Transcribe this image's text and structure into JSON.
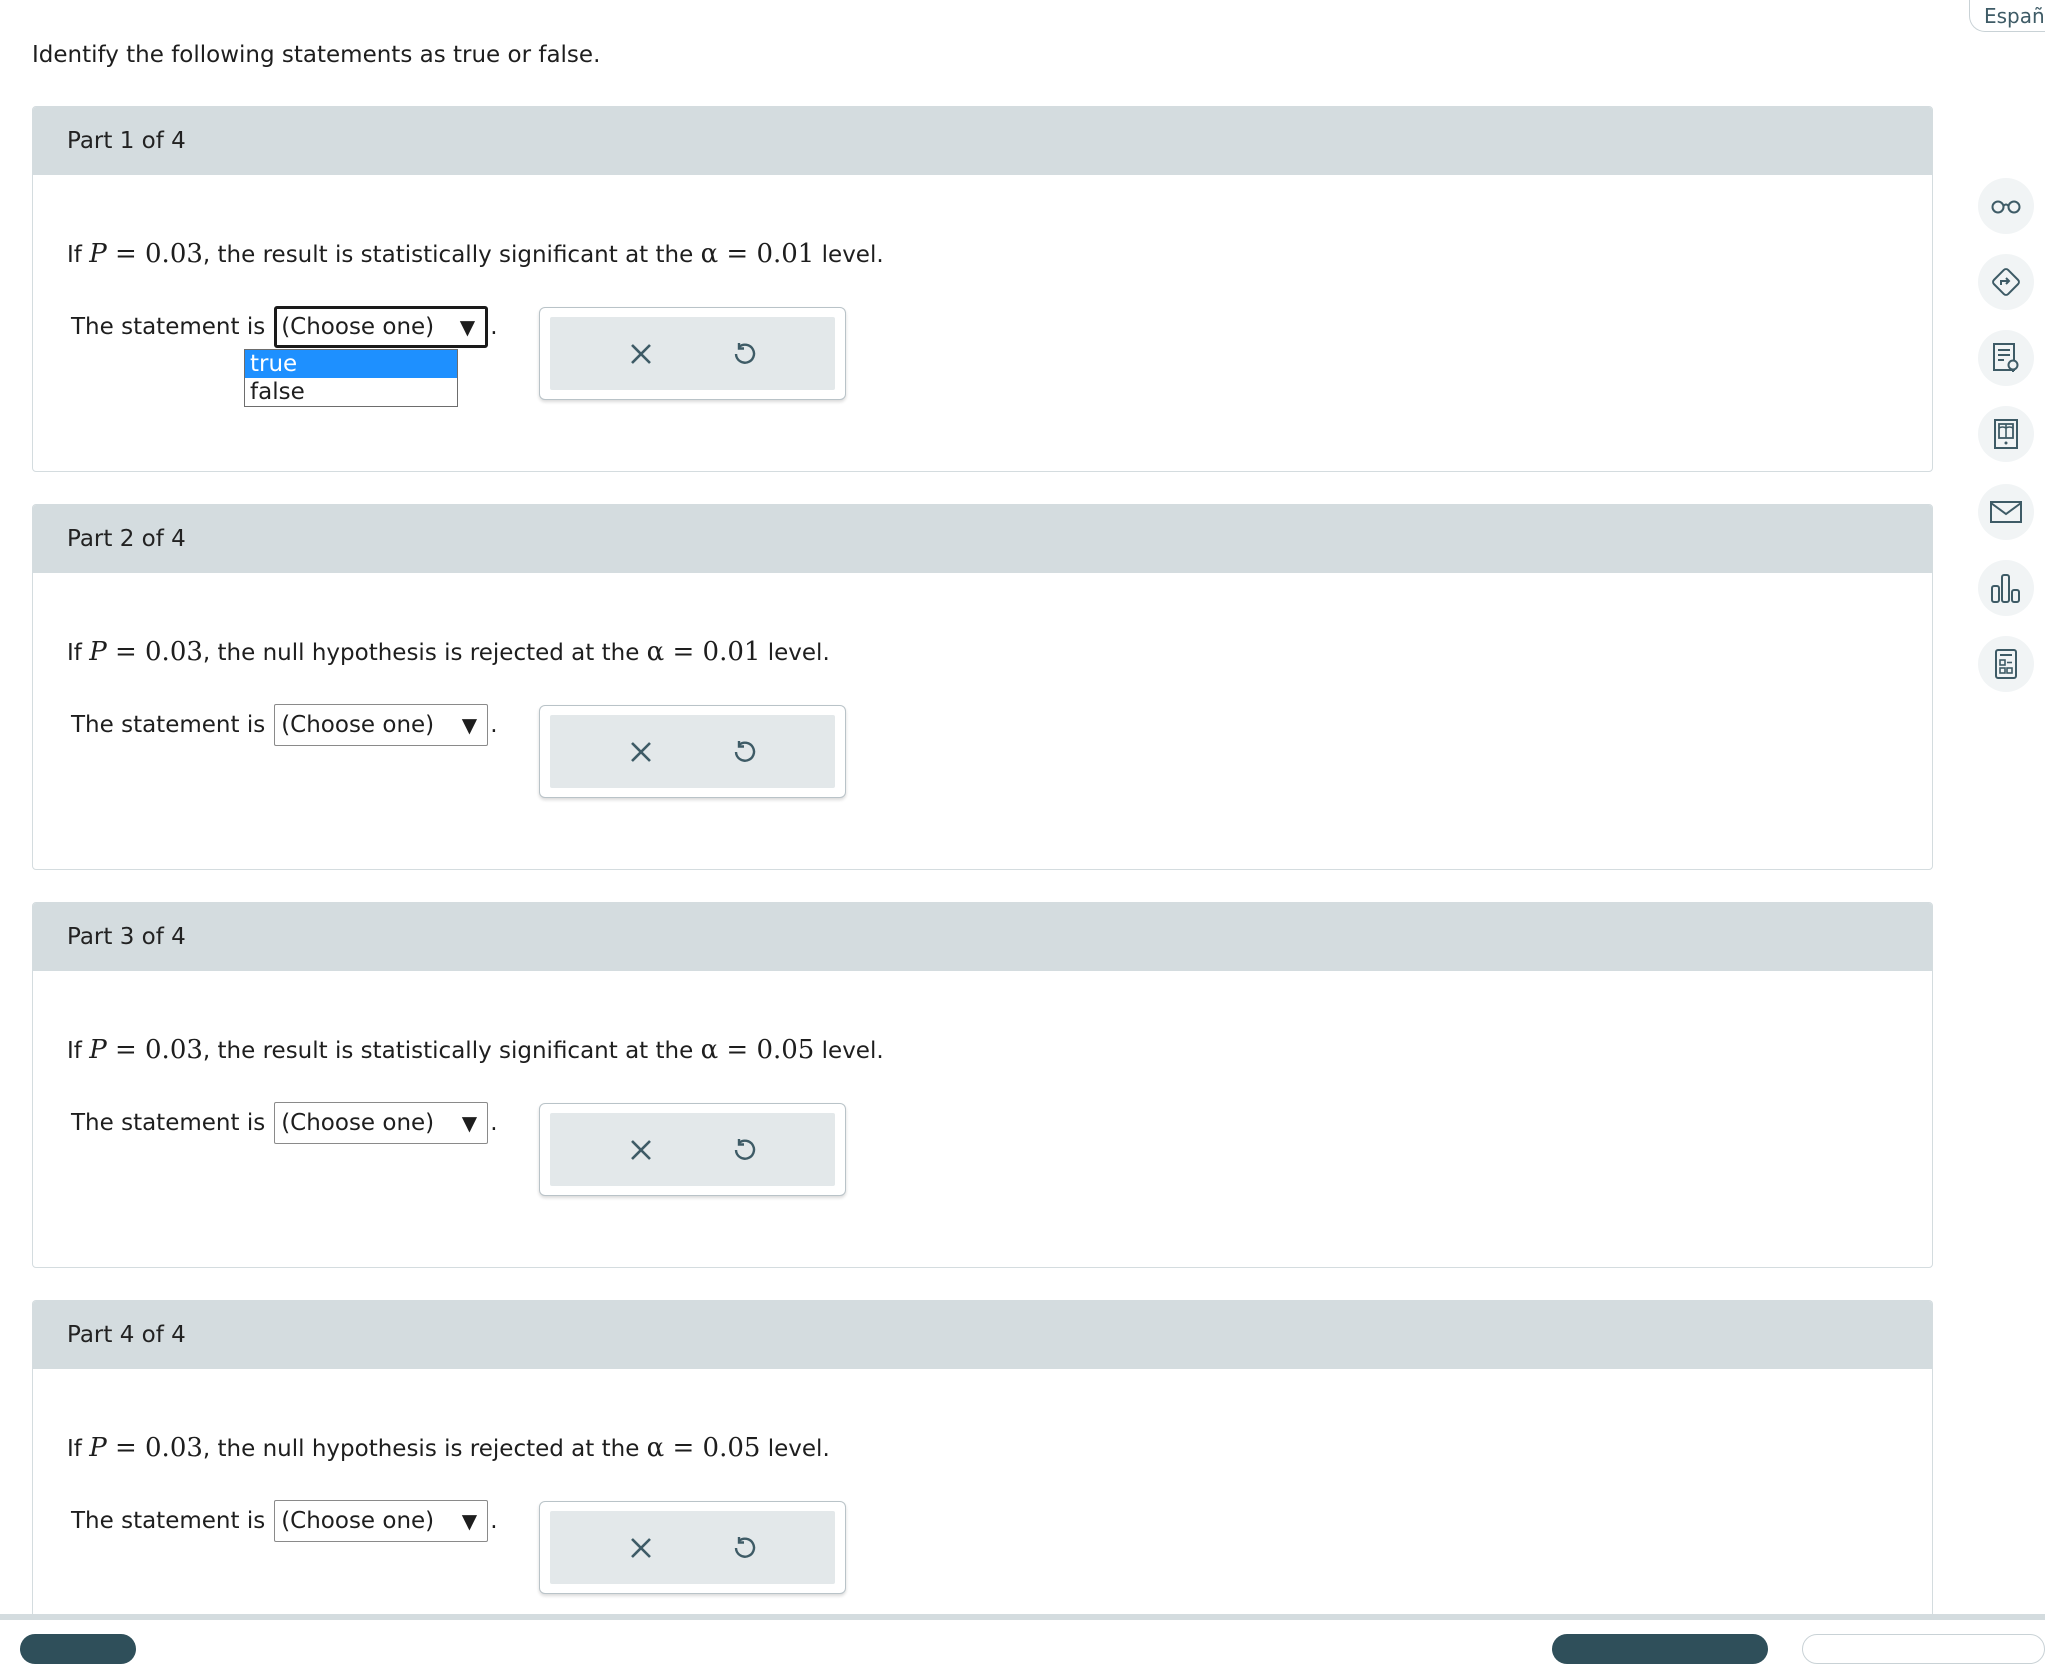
{
  "instructions": "Identify the following statements as true or false.",
  "language_link": "Españo",
  "answer_prefix": "The statement is",
  "parts": [
    {
      "header": "Part 1 of 4",
      "question": {
        "pre": "If ",
        "p_sym": "P",
        "p_eq": " = 0.03",
        "mid": ", the result is statistically significant at the ",
        "alpha_sym": "α",
        "alpha_eq": " = 0.01",
        "post": " level."
      },
      "select_value": "(Choose one)",
      "open": true
    },
    {
      "header": "Part 2 of 4",
      "question": {
        "pre": "If ",
        "p_sym": "P",
        "p_eq": " = 0.03",
        "mid": ", the null hypothesis is rejected at the ",
        "alpha_sym": "α",
        "alpha_eq": " = 0.01",
        "post": " level."
      },
      "select_value": "(Choose one)",
      "open": false
    },
    {
      "header": "Part 3 of 4",
      "question": {
        "pre": "If ",
        "p_sym": "P",
        "p_eq": " = 0.03",
        "mid": ", the result is statistically significant at the ",
        "alpha_sym": "α",
        "alpha_eq": " = 0.05",
        "post": " level."
      },
      "select_value": "(Choose one)",
      "open": false
    },
    {
      "header": "Part 4 of 4",
      "question": {
        "pre": "If ",
        "p_sym": "P",
        "p_eq": " = 0.03",
        "mid": ", the null hypothesis is rejected at the ",
        "alpha_sym": "α",
        "alpha_eq": " = 0.05",
        "post": " level."
      },
      "select_value": "(Choose one)",
      "open": false
    }
  ],
  "dropdown_options": [
    {
      "label": "true",
      "highlighted": true
    },
    {
      "label": "false",
      "highlighted": false
    }
  ],
  "sidebar_icons": [
    "glasses-icon",
    "direction-sign-icon",
    "notes-icon",
    "ebook-icon",
    "mail-icon",
    "bar-chart-icon",
    "calculator-icon"
  ],
  "colors": {
    "header_bg": "#d4dcdf",
    "tool_bg": "#e3e8ea",
    "icon_color": "#3e5b66",
    "highlight": "#1e90ff",
    "bottom_button": "#2f4f5a"
  }
}
